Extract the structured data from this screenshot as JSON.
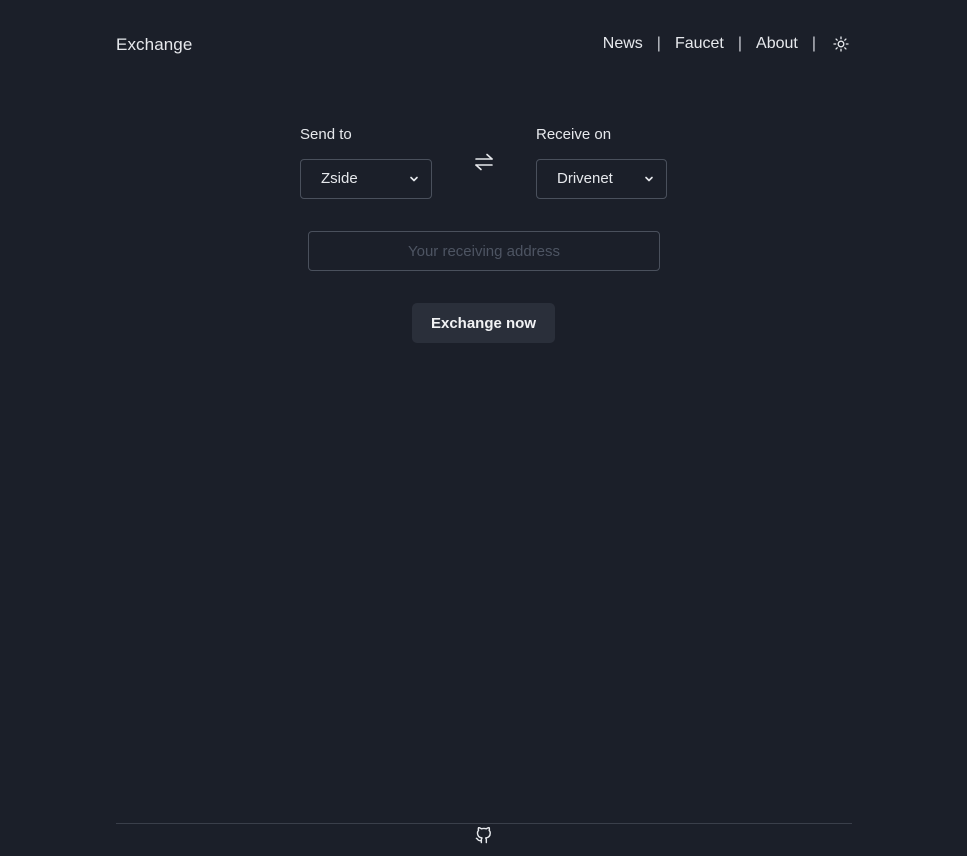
{
  "header": {
    "brand": "Exchange",
    "nav": [
      {
        "label": "News"
      },
      {
        "label": "Faucet"
      },
      {
        "label": "About"
      }
    ],
    "separator": "|",
    "theme_icon": "sun-icon"
  },
  "form": {
    "send": {
      "label": "Send to",
      "selected": "Zside"
    },
    "swap_icon": "swap-arrows-icon",
    "receive": {
      "label": "Receive on",
      "selected": "Drivenet"
    },
    "address": {
      "value": "",
      "placeholder": "Your receiving address"
    },
    "submit_label": "Exchange now"
  },
  "footer": {
    "icon": "github-icon"
  },
  "colors": {
    "background": "#1b1f29",
    "text": "#e6e8ec",
    "border": "#4a505c",
    "button": "#2a2f3a"
  }
}
